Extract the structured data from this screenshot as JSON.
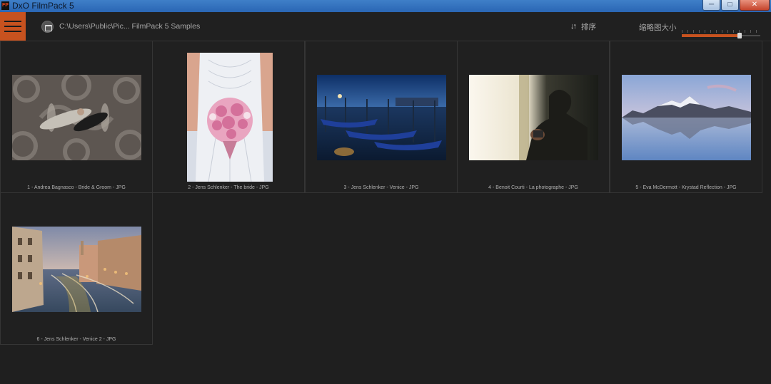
{
  "window": {
    "title": "DxO FilmPack 5",
    "app_icon_text": "FP",
    "controls": {
      "minimize": "─",
      "maximize": "□",
      "close": "✕"
    }
  },
  "toolbar": {
    "path": "C:\\Users\\Public\\Pic... FilmPack 5 Samples",
    "sort_label": "排序",
    "sort_icon": "↓↑",
    "thumb_size_label": "缩略图大小",
    "thumb_size_level": 0.75,
    "accent_color": "#c7521f"
  },
  "thumbnails": [
    {
      "caption": "1 - Andrea Bagnasco - Bride & Groom - JPG"
    },
    {
      "caption": "2 - Jens Schlenker - The bride - JPG"
    },
    {
      "caption": "3 - Jens Schlenker - Venice - JPG"
    },
    {
      "caption": "4 - Benoit Courti - La photographe - JPG"
    },
    {
      "caption": "5 - Eva McDermott - Krystad Reflection - JPG"
    },
    {
      "caption": "6 - Jens Schlenker - Venice 2 - JPG"
    }
  ]
}
